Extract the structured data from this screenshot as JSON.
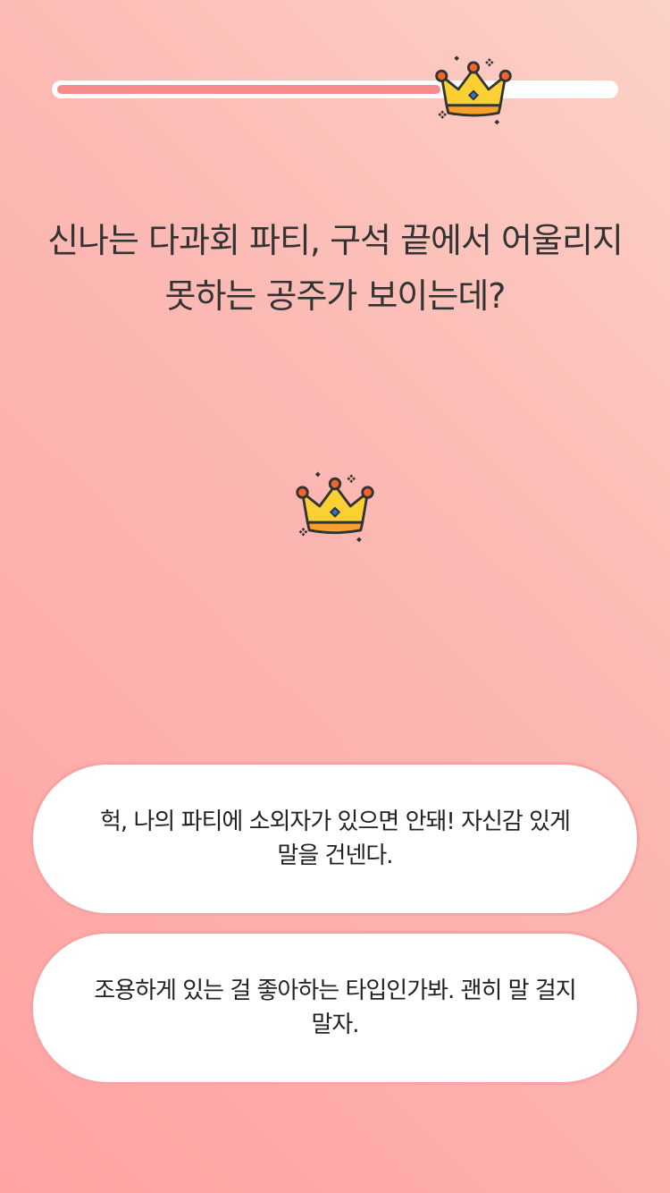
{
  "progress": {
    "fraction": 0.69,
    "fill_color": "#f98b8d",
    "track_color": "#ffffff",
    "indicator_icon": "crown-icon"
  },
  "question": {
    "line1": "신나는 다과회 파티, 구석 끝에서 어울리지",
    "line2": "못하는 공주가 보이는데?"
  },
  "illustration": {
    "icon": "crown-icon"
  },
  "answers": [
    {
      "line1": "헉, 나의 파티에 소외자가 있으면 안돼! 자신감 있게",
      "line2": "말을 건넨다."
    },
    {
      "line1": "조용하게 있는 걸 좋아하는 타입인가봐. 괜히 말 걸지",
      "line2": "말자."
    }
  ],
  "colors": {
    "background_top": "#fcd2c6",
    "background_bottom": "#ffa3a3",
    "answer_border": "#f7a3a3",
    "text": "#333333"
  }
}
